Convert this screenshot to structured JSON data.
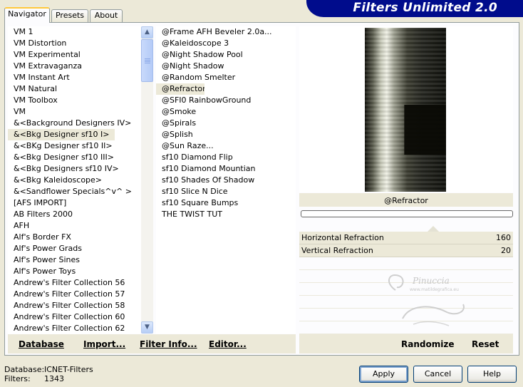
{
  "window": {
    "title": "Filters Unlimited 2.0"
  },
  "tabs": [
    {
      "label": "Navigator",
      "active": true
    },
    {
      "label": "Presets",
      "active": false
    },
    {
      "label": "About",
      "active": false
    }
  ],
  "categories": {
    "selected_index": 9,
    "items": [
      "VM 1",
      "VM Distortion",
      "VM Experimental",
      "VM Extravaganza",
      "VM Instant Art",
      "VM Natural",
      "VM Toolbox",
      "VM",
      "&<Background Designers IV>",
      "&<Bkg Designer sf10 I>",
      "&<BKg Designer sf10 II>",
      "&<Bkg Designer sf10 III>",
      "&<Bkg Designers sf10 IV>",
      "&<Bkg Kaleidoscope>",
      "&<Sandflower Specials^v^ >",
      "[AFS IMPORT]",
      "AB Filters 2000",
      "AFH",
      "Alf's Border FX",
      "Alf's Power Grads",
      "Alf's Power Sines",
      "Alf's Power Toys",
      "Andrew's Filter Collection 56",
      "Andrew's Filter Collection 57",
      "Andrew's Filter Collection 58",
      "Andrew's Filter Collection 60",
      "Andrew's Filter Collection 62"
    ]
  },
  "filters": {
    "selected_index": 5,
    "items": [
      "@Frame AFH Beveler 2.0a...",
      "@Kaleidoscope 3",
      "@Night Shadow Pool",
      "@Night Shadow",
      "@Random Smelter",
      "@Refractor",
      "@SFI0 RainbowGround",
      "@Smoke",
      "@Spirals",
      "@Splish",
      "@Sun Raze...",
      "sf10 Diamond Flip",
      "sf10 Diamond Mountian",
      "sf10 Shades Of Shadow",
      "sf10 Slice N Dice",
      "sf10 Square Bumps",
      "THE TWIST TUT"
    ]
  },
  "preview": {
    "filter_name": "@Refractor",
    "progress": 0
  },
  "parameters": [
    {
      "label": "Horizontal Refraction",
      "value": "160"
    },
    {
      "label": "Vertical Refraction",
      "value": "20"
    }
  ],
  "watermark": {
    "logo_text": "Pinuccia",
    "logo_url": "www.matildegrafica.eu"
  },
  "left_bar": {
    "database": "Database",
    "import": "Import...",
    "filter_info": "Filter Info...",
    "editor": "Editor..."
  },
  "right_bar": {
    "randomize": "Randomize",
    "reset": "Reset"
  },
  "status": {
    "database_label": "Database:",
    "database_value": "ICNET-Filters",
    "filters_label": "Filters:",
    "filters_value": "1343"
  },
  "dialog_buttons": {
    "apply": "Apply",
    "cancel": "Cancel",
    "help": "Help"
  },
  "icons": {
    "scroll_up": "chevron-up-icon",
    "scroll_down": "chevron-down-icon"
  },
  "colors": {
    "banner": "#000c8c",
    "tab_highlight": "#ffc83c",
    "dialog_bg": "#ece9d8"
  }
}
